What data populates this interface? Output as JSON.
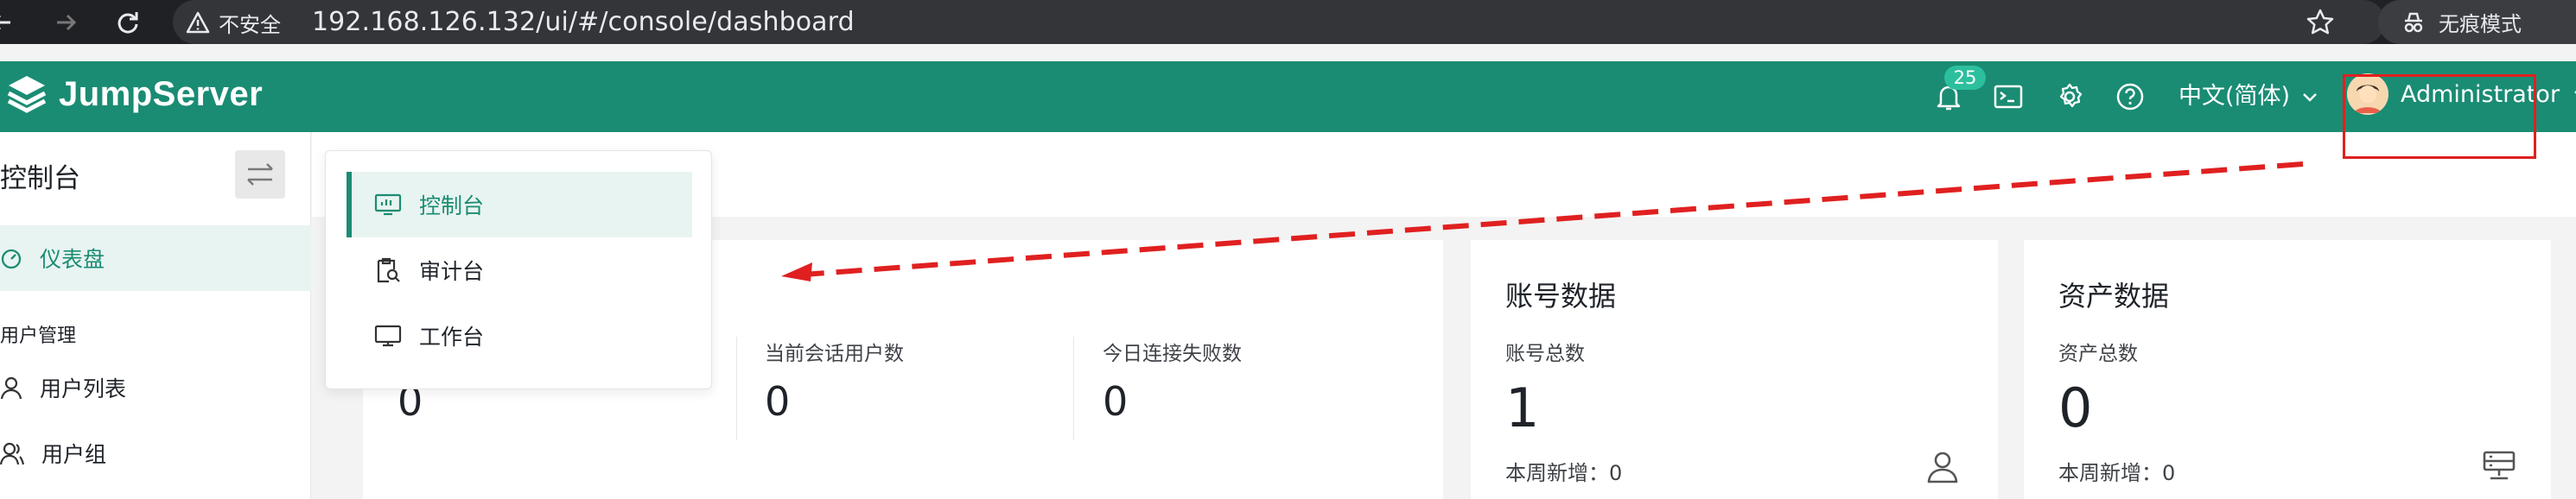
{
  "browser": {
    "insecure_label": "不安全",
    "url": "192.168.126.132/ui/#/console/dashboard",
    "incognito_label": "无痕模式"
  },
  "header": {
    "brand": "JumpServer",
    "notification_count": "25",
    "language": "中文(简体)",
    "user_name": "Administrator"
  },
  "sidebar": {
    "title": "控制台",
    "dashboard_label": "仪表盘",
    "group_label": "用户管理",
    "items": [
      {
        "label": "用户列表",
        "icon": "user-icon"
      },
      {
        "label": "用户组",
        "icon": "user-group-icon"
      }
    ]
  },
  "dropdown": {
    "items": [
      {
        "label": "控制台",
        "icon": "console-icon",
        "active": true
      },
      {
        "label": "审计台",
        "icon": "audit-icon",
        "active": false
      },
      {
        "label": "工作台",
        "icon": "workbench-icon",
        "active": false
      }
    ]
  },
  "sessions_card": {
    "metrics": [
      {
        "label": "",
        "value": "0"
      },
      {
        "label": "当前会话用户数",
        "value": "0"
      },
      {
        "label": "今日连接失败数",
        "value": "0"
      }
    ]
  },
  "account_card": {
    "title": "账号数据",
    "total_label": "账号总数",
    "total_value": "1",
    "week_label": "本周新增：",
    "week_value": "0",
    "icon": "user-icon"
  },
  "asset_card": {
    "title": "资产数据",
    "total_label": "资产总数",
    "total_value": "0",
    "week_label": "本周新增：",
    "week_value": "0",
    "icon": "server-icon"
  },
  "colors": {
    "brand": "#1a8c73",
    "annotation": "#e02020"
  }
}
